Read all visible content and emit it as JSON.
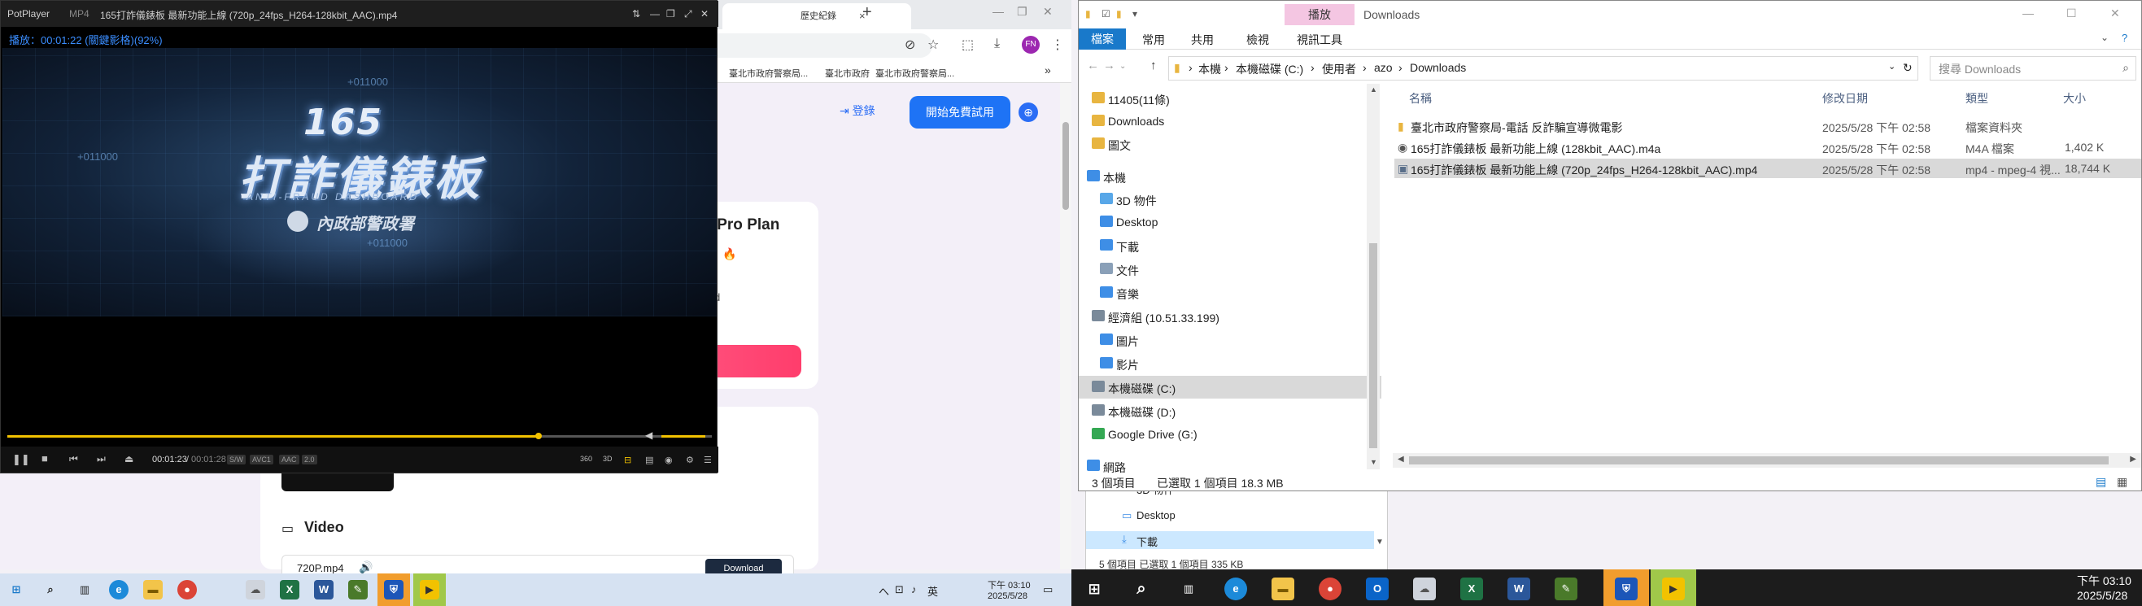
{
  "browser": {
    "tab_title": "歷史紀錄",
    "profile_initials": "FN",
    "bookmarks": [
      "臺北市政府警察局...",
      "臺北市政府",
      "臺北市政府警察局..."
    ],
    "login_label": "登錄",
    "trial_button": "開始免費試用",
    "plan_title": "er Pro Plan",
    "fire_icon": "🔥",
    "truncated_text": "d",
    "video_heading": "Video",
    "video_format": "720P.mp4",
    "download_label": "Download"
  },
  "potplayer": {
    "app_name": "PotPlayer",
    "format": "MP4",
    "file_title": "165打詐儀錶板 最新功能上線 (720p_24fps_H264-128kbit_AAC).mp4",
    "osd": "播放：00:01:22 (關鍵影格)(92%)",
    "video_text": {
      "number": "165",
      "title": "打詐儀錶板",
      "subtitle": "ANTI-FRAUD DASHBOARD",
      "code_top": "+011000",
      "code_left": "+011000",
      "code_bottom": "+011000",
      "emblem": "內政部警政署"
    },
    "time_current": "00:01:23",
    "time_total": "00:01:28",
    "codec_chips": [
      "S/W",
      "AVC1",
      "AAC",
      "2.0"
    ],
    "progress_fraction": 0.943,
    "volume_fraction": 1.0,
    "right_ctrl": [
      "360",
      "3D"
    ]
  },
  "explorer": {
    "ribbon_context_tab": "播放",
    "window_title": "Downloads",
    "ribbon_tabs": [
      "檔案",
      "常用",
      "共用",
      "檢視",
      "視訊工具"
    ],
    "path": [
      "本機",
      "本機磁碟 (C:)",
      "使用者",
      "azo",
      "Downloads"
    ],
    "search_placeholder": "搜尋 Downloads",
    "nav_items": [
      {
        "label": "11405(11條)",
        "icon": "folder-icon"
      },
      {
        "label": "Downloads",
        "icon": "folder-icon"
      },
      {
        "label": "圖文",
        "icon": "folder-icon"
      },
      {
        "label": "本機",
        "icon": "computer-icon"
      },
      {
        "label": "3D 物件",
        "icon": "cube-icon"
      },
      {
        "label": "Desktop",
        "icon": "desktop-icon"
      },
      {
        "label": "下載",
        "icon": "download-icon"
      },
      {
        "label": "文件",
        "icon": "document-icon"
      },
      {
        "label": "音樂",
        "icon": "music-icon"
      },
      {
        "label": "經濟組 (10.51.33.199)",
        "icon": "network-drive-icon"
      },
      {
        "label": "圖片",
        "icon": "picture-icon"
      },
      {
        "label": "影片",
        "icon": "video-icon"
      },
      {
        "label": "本機磁碟 (C:)",
        "icon": "drive-icon"
      },
      {
        "label": "本機磁碟 (D:)",
        "icon": "drive-icon"
      },
      {
        "label": "Google Drive (G:)",
        "icon": "google-drive-icon"
      },
      {
        "label": "網路",
        "icon": "network-icon"
      }
    ],
    "columns": [
      "名稱",
      "修改日期",
      "類型",
      "大小"
    ],
    "files": [
      {
        "name": "臺北市政府警察局-電話 反詐騙宣導微電影",
        "date": "2025/5/28 下午 02:58",
        "type": "檔案資料夾",
        "size": ""
      },
      {
        "name": "165打詐儀錶板 最新功能上線 (128kbit_AAC).m4a",
        "date": "2025/5/28 下午 02:58",
        "type": "M4A 檔案",
        "size": "1,402 K"
      },
      {
        "name": "165打詐儀錶板 最新功能上線 (720p_24fps_H264-128kbit_AAC).mp4",
        "date": "2025/5/28 下午 02:58",
        "type": "mp4 - mpeg-4 視...",
        "size": "18,744 K"
      }
    ],
    "status_count": "3 個項目",
    "status_selected": "已選取 1 個項目  18.3 MB"
  },
  "explorer_behind": {
    "items": [
      "3D 物件",
      "Desktop",
      "下載"
    ],
    "status": "5 個項目     已選取 1 個項目  335 KB"
  },
  "taskbar_left": {
    "ime_lang": "英",
    "time": "下午 03:10",
    "date": "2025/5/28",
    "tray_chars": [
      "へ",
      "⊡",
      "♪",
      "英"
    ]
  },
  "taskbar_right": {
    "time": "下午 03:10",
    "date": "2025/5/28"
  },
  "colors": {
    "accent_blue": "#1e73f5",
    "explorer_file_tab": "#1979ca",
    "potplayer_yellow": "#f2c200",
    "play_context_tab": "#f4c6e2"
  }
}
